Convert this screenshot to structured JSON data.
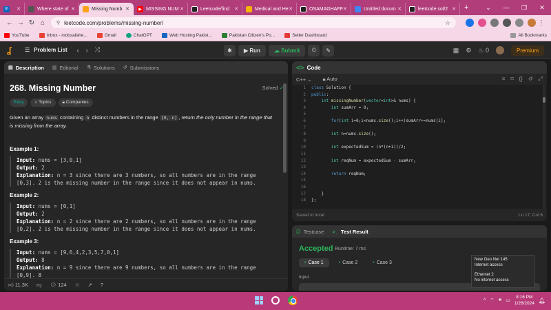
{
  "browser": {
    "tabs": [
      {
        "label": "in",
        "color": "#0a66c2"
      },
      {
        "label": "Where state of",
        "color": "#555"
      },
      {
        "label": "Missing Numb",
        "color": "#ffa116",
        "active": true
      },
      {
        "label": "MISSING NUM",
        "color": "#ff0000"
      },
      {
        "label": "Leetcode/find",
        "color": "#222"
      },
      {
        "label": "Medical and He",
        "color": "#f4b400"
      },
      {
        "label": "OSAMAGHAFF",
        "color": "#222"
      },
      {
        "label": "Untitled docum",
        "color": "#4285f4"
      },
      {
        "label": "leetcode.sol/2",
        "color": "#222"
      }
    ],
    "new_tab": "+",
    "url": "leetcode.com/problems/missing-number/",
    "bookmarks": [
      {
        "label": "YouTube",
        "color": "#ff0000"
      },
      {
        "label": "Inbox - mdosafahe...",
        "color": "#ea4335"
      },
      {
        "label": "Gmail",
        "color": "#ea4335"
      },
      {
        "label": "ChatGPT",
        "color": "#10a37f"
      },
      {
        "label": "Web Hosting Pakist...",
        "color": "#1565c0"
      },
      {
        "label": "Pakistan Citizen's Po...",
        "color": "#2e7d32"
      },
      {
        "label": "Seller Dashboard",
        "color": "#e53935"
      }
    ],
    "all_bookmarks": "All Bookmarks"
  },
  "leetcode_nav": {
    "problem_list": "Problem List",
    "run": "Run",
    "submit": "Submit",
    "streak": "0",
    "premium": "Premium"
  },
  "left_panel": {
    "tabs": [
      "Description",
      "Editorial",
      "Solutions",
      "Submissions"
    ],
    "title": "268. Missing Number",
    "status": "Solved",
    "chips": [
      "Easy",
      "Topics",
      "Companies"
    ],
    "desc_part1": "Given an array ",
    "desc_code1": "nums",
    "desc_part2": " containing ",
    "desc_code2": "n",
    "desc_part3": " distinct numbers in the range ",
    "desc_code3": "[0, n]",
    "desc_part4": ", return ",
    "desc_italic": "the only number in the range that is missing from the array.",
    "examples": [
      {
        "heading": "Example 1:",
        "input": "nums = [3,0,1]",
        "output": "2",
        "explanation": "n = 3 since there are 3 numbers, so all numbers are in the range [0,3]. 2 is the missing number in the range since it does not appear in nums."
      },
      {
        "heading": "Example 2:",
        "input": "nums = [0,1]",
        "output": "2",
        "explanation": "n = 2 since there are 2 numbers, so all numbers are in the range [0,2]. 2 is the missing number in the range since it does not appear in nums."
      },
      {
        "heading": "Example 3:",
        "input": "nums = [9,6,4,2,3,5,7,0,1]",
        "output": "8",
        "explanation": "n = 9 since there are 9 numbers, so all numbers are in the range [0,9]. 8"
      }
    ],
    "labels": {
      "input": "Input:",
      "output": "Output:",
      "explanation": "Explanation:"
    },
    "likes": "11.3K",
    "comments": "124"
  },
  "code_panel": {
    "title": "Code",
    "language": "C++",
    "mode": "Auto",
    "lines": [
      "class Solution {",
      "public:",
      "    int missingNumber(vector<int>& nums) {",
      "        int sumArr = 0;",
      "",
      "        for(int i=0;i<nums.size();i++)sumArr+=nums[i];",
      "",
      "        int n=nums.size();",
      "",
      "        int expectedSum = (n*(n+1))/2;",
      "",
      "        int reqNum = expectedSum - sumArr;",
      "",
      "        return reqNum;",
      "",
      "",
      "    }",
      "};"
    ],
    "saved": "Saved to local",
    "cursor": "Ln 17, Col 6"
  },
  "test_panel": {
    "tabs": [
      "Testcase",
      "Test Result"
    ],
    "result": "Accepted",
    "runtime": "Runtime: 7 ms",
    "cases": [
      "Case 1",
      "Case 2",
      "Case 3"
    ],
    "input_label": "Input"
  },
  "network_popup": {
    "line1": "New Geo Net 145",
    "line2": "Internet access",
    "line3": "Ethernet 2",
    "line4": "No internet access"
  },
  "taskbar": {
    "time": "8:16 PM",
    "date": "1/26/2024",
    "tray_arrow": "^"
  }
}
